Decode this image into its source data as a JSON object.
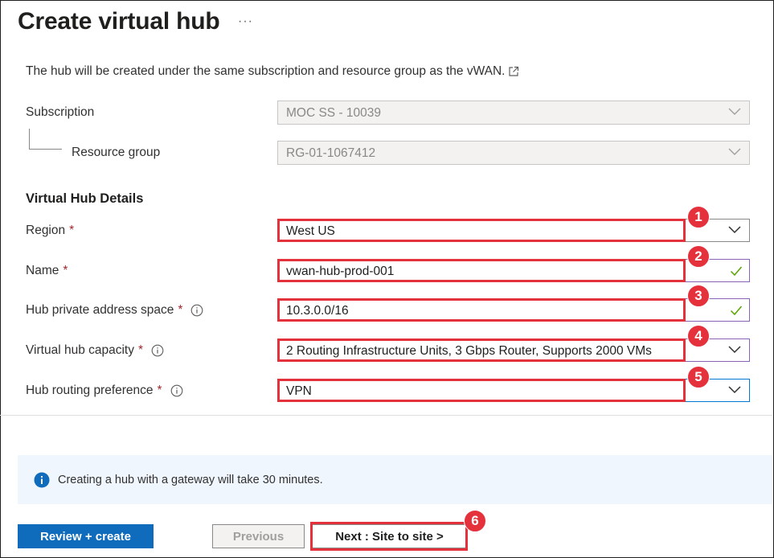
{
  "header": {
    "title": "Create virtual hub",
    "more_label": "···"
  },
  "intro": {
    "text": "The hub will be created under the same subscription and resource group as the vWAN.",
    "link_icon": "external-link-icon"
  },
  "subscription": {
    "label": "Subscription",
    "value": "MOC SS - 10039",
    "disabled": true
  },
  "resource_group": {
    "label": "Resource group",
    "value": "RG-01-1067412",
    "disabled": true
  },
  "details": {
    "title": "Virtual Hub Details",
    "required_mark": "*",
    "region": {
      "label": "Region",
      "value": "West US",
      "badge": "1"
    },
    "name": {
      "label": "Name",
      "value": "vwan-hub-prod-001",
      "badge": "2"
    },
    "address_space": {
      "label": "Hub private address space",
      "value": "10.3.0.0/16",
      "badge": "3"
    },
    "capacity": {
      "label": "Virtual hub capacity",
      "value": "2 Routing Infrastructure Units, 3 Gbps Router, Supports 2000 VMs",
      "badge": "4"
    },
    "routing_preference": {
      "label": "Hub routing preference",
      "value": "VPN",
      "badge": "5"
    }
  },
  "banner": {
    "text": "Creating a hub with a gateway will take 30 minutes.",
    "icon": "info-icon"
  },
  "footer": {
    "review_create": "Review + create",
    "previous": "Previous",
    "next": "Next : Site to site >",
    "next_badge": "6"
  },
  "colors": {
    "primary": "#0f6cbd",
    "highlight": "#e5313c",
    "required": "#a4262c",
    "valid": "#8764b8",
    "check": "#57a300",
    "banner_bg": "#f0f6fe"
  }
}
